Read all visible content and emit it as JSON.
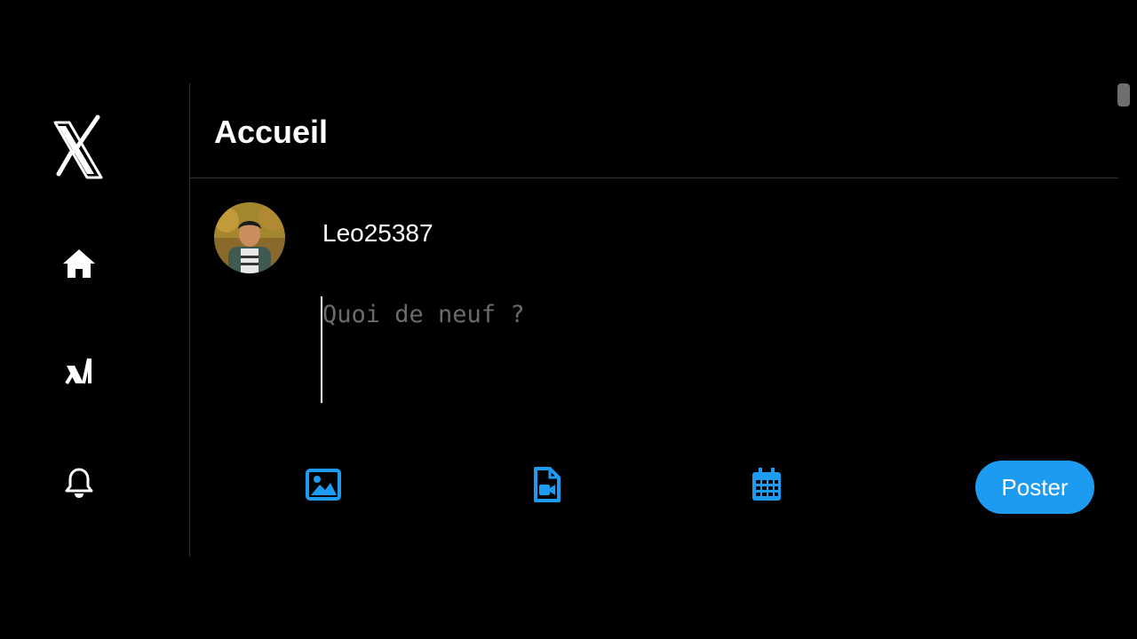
{
  "header": {
    "title": "Accueil"
  },
  "sidebar": {
    "logo": "x-logo-icon",
    "items": [
      {
        "icon": "home-icon"
      },
      {
        "icon": "x-ai-icon"
      },
      {
        "icon": "bell-icon"
      }
    ]
  },
  "composer": {
    "username": "Leo25387",
    "placeholder": "Quoi de neuf ?",
    "value": ""
  },
  "toolbar": {
    "icons": [
      "image-icon",
      "video-file-icon",
      "calendar-icon"
    ],
    "post_label": "Poster"
  },
  "colors": {
    "background": "#000000",
    "accent": "#1d9bf0",
    "divider": "#2f3336",
    "placeholder": "#6b6b6b"
  }
}
